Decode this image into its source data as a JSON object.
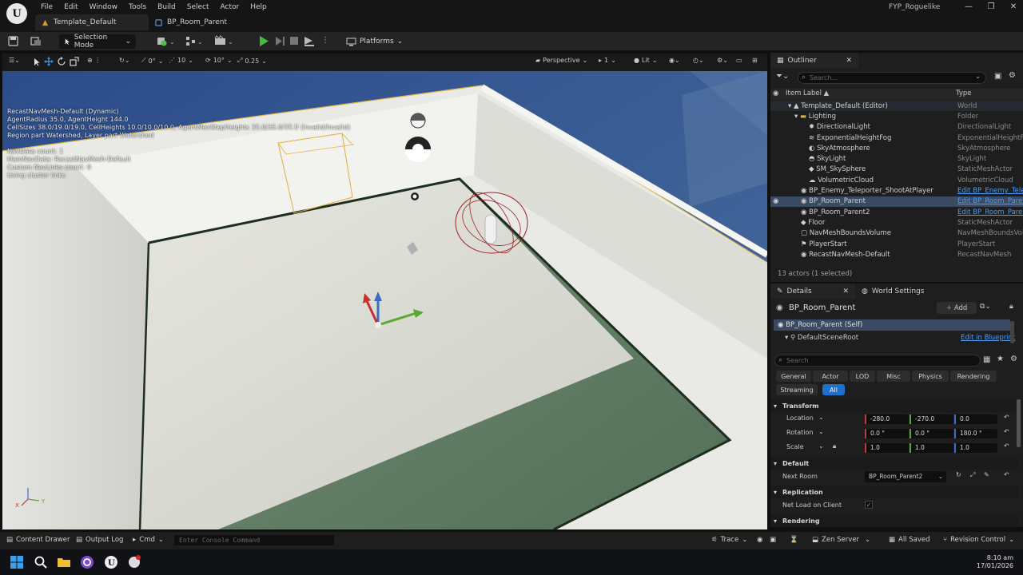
{
  "app": {
    "menu": [
      "File",
      "Edit",
      "Window",
      "Tools",
      "Build",
      "Select",
      "Actor",
      "Help"
    ],
    "tabs": [
      "Template_Default",
      "BP_Room_Parent"
    ],
    "project_name": "FYP_Roguelike",
    "window_controls": [
      "—",
      "❐",
      "✕"
    ]
  },
  "toolbar": {
    "selection_mode": "Selection Mode",
    "platforms": "Platforms"
  },
  "viewport_toolbar": {
    "rot_snap": "0°",
    "grid_snap": "10",
    "angle_snap": "10°",
    "scale_snap": "0.25",
    "perspective": "Perspective",
    "camera_speed": "1",
    "view_mode": "Lit"
  },
  "navmesh_overlay": [
    "RecastNavMesh-Default (Dynamic)",
    "AgentRadius 35.0, AgentHeight 144.0",
    "CellSizes 38.0/19.0/19.0, CellHeights 10.0/10.0/10.0, AgentMaxStepHeights 35.0/35.0/35.0 (Invalid/Invalid)",
    "Region part Watershed, Layer part Watershed",
    "",
    "NavData count: 1",
    "MainNavData: RecastNavMesh-Default",
    "Custom NavLinks count: 0",
    "Using cluster links"
  ],
  "outliner": {
    "tab_label": "Outliner",
    "search_placeholder": "Search...",
    "col_label": "Item Label ▲",
    "col_type": "Type",
    "rows": [
      {
        "label": "Template_Default (Editor)",
        "type": "World"
      },
      {
        "label": "Lighting",
        "type": "Folder"
      },
      {
        "label": "DirectionalLight",
        "type": "DirectionalLight"
      },
      {
        "label": "ExponentialHeightFog",
        "type": "ExponentialHeightFog"
      },
      {
        "label": "SkyAtmosphere",
        "type": "SkyAtmosphere"
      },
      {
        "label": "SkyLight",
        "type": "SkyLight"
      },
      {
        "label": "SM_SkySphere",
        "type": "StaticMeshActor"
      },
      {
        "label": "VolumetricCloud",
        "type": "VolumetricCloud"
      },
      {
        "label": "BP_Enemy_Teleporter_ShootAtPlayer",
        "type": "Edit BP_Enemy_Teleporter"
      },
      {
        "label": "BP_Room_Parent",
        "type": "Edit BP_Room_Parent"
      },
      {
        "label": "BP_Room_Parent2",
        "type": "Edit BP_Room_Parent"
      },
      {
        "label": "Floor",
        "type": "StaticMeshActor"
      },
      {
        "label": "NavMeshBoundsVolume",
        "type": "NavMeshBoundsVolume"
      },
      {
        "label": "PlayerStart",
        "type": "PlayerStart"
      },
      {
        "label": "RecastNavMesh-Default",
        "type": "RecastNavMesh"
      }
    ],
    "footer": "13 actors (1 selected)"
  },
  "details": {
    "tab_details": "Details",
    "tab_world": "World Settings",
    "actor_name": "BP_Room_Parent",
    "add_label": "Add",
    "self_label": "BP_Room_Parent (Self)",
    "scene_root": "DefaultSceneRoot",
    "edit_in_blueprint": "Edit in Blueprint",
    "search_placeholder": "Search",
    "categories": [
      "General",
      "Actor",
      "LOD",
      "Misc",
      "Physics",
      "Rendering",
      "Streaming",
      "All"
    ],
    "transform_header": "Transform",
    "location_label": "Location",
    "location": [
      "-280.0",
      "-270.0",
      "0.0"
    ],
    "rotation_label": "Rotation",
    "rotation": [
      "0.0 °",
      "0.0 °",
      "180.0 °"
    ],
    "scale_label": "Scale",
    "scale": [
      "1.0",
      "1.0",
      "1.0"
    ],
    "default_header": "Default",
    "next_room_label": "Next Room",
    "next_room_value": "BP_Room_Parent2",
    "replication_header": "Replication",
    "net_load_label": "Net Load on Client",
    "rendering_header": "Rendering"
  },
  "bottom": {
    "content_drawer": "Content Drawer",
    "output_log": "Output Log",
    "cmd": "Cmd",
    "console_placeholder": "Enter Console Command",
    "trace": "Trace",
    "zen_server": "Zen Server",
    "all_saved": "All Saved",
    "revision_control": "Revision Control"
  },
  "taskbar": {
    "time": "8:10 am",
    "date": "17/01/2026"
  },
  "colors": {
    "accent": "#1f6fd0",
    "link": "#4f9cf0",
    "selection": "#3b4a63",
    "sky": "#2e4f8c",
    "floor_green": "#4a6a50"
  }
}
